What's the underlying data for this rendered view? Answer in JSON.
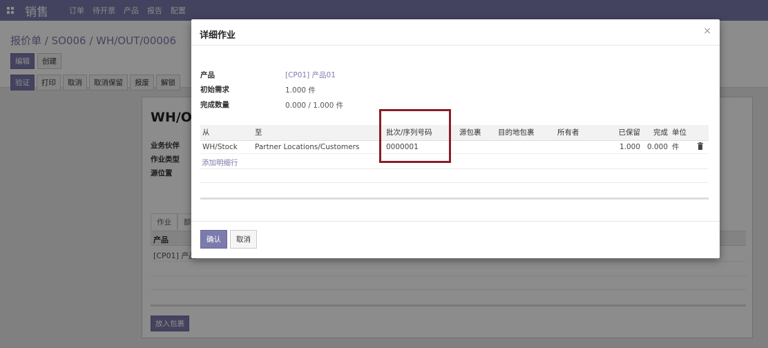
{
  "topbar": {
    "app_name": "销售",
    "menu": [
      "订单",
      "待开票",
      "产品",
      "报告",
      "配置"
    ]
  },
  "control_panel": {
    "breadcrumb": "报价单 / SO006 / WH/OUT/00006",
    "edit_label": "编辑",
    "create_label": "创建",
    "status_buttons": [
      "验证",
      "打印",
      "取消",
      "取消保留",
      "报废",
      "解锁"
    ]
  },
  "sheet": {
    "title": "WH/OU",
    "field_labels": [
      "业务伙伴",
      "作业类型",
      "源位置"
    ],
    "tabs": [
      "作业",
      "额"
    ],
    "list_header": "产品",
    "list_row": "[CP01] 产品",
    "pack_button": "放入包裹"
  },
  "modal": {
    "title": "详细作业",
    "close": "×",
    "product_label": "产品",
    "product_value": "[CP01] 产品01",
    "initial_demand_label": "初始需求",
    "initial_demand_value": "1.000 件",
    "done_qty_label": "完成数量",
    "done_qty_value": "0.000 / 1.000 件",
    "columns": {
      "from": "从",
      "to": "至",
      "lot": "批次/序列号码",
      "src_pkg": "源包裹",
      "dst_pkg": "目的地包裹",
      "owner": "所有者",
      "reserved": "已保留",
      "done": "完成",
      "unit": "单位"
    },
    "rows": [
      {
        "from": "WH/Stock",
        "to": "Partner Locations/Customers",
        "lot": "0000001",
        "src_pkg": "",
        "dst_pkg": "",
        "owner": "",
        "reserved": "1.000",
        "done": "0.000",
        "unit": "件"
      }
    ],
    "add_line": "添加明细行",
    "confirm_label": "确认",
    "cancel_label": "取消"
  },
  "colors": {
    "brand": "#7c7bad",
    "highlight_box": "#8a1c26"
  }
}
